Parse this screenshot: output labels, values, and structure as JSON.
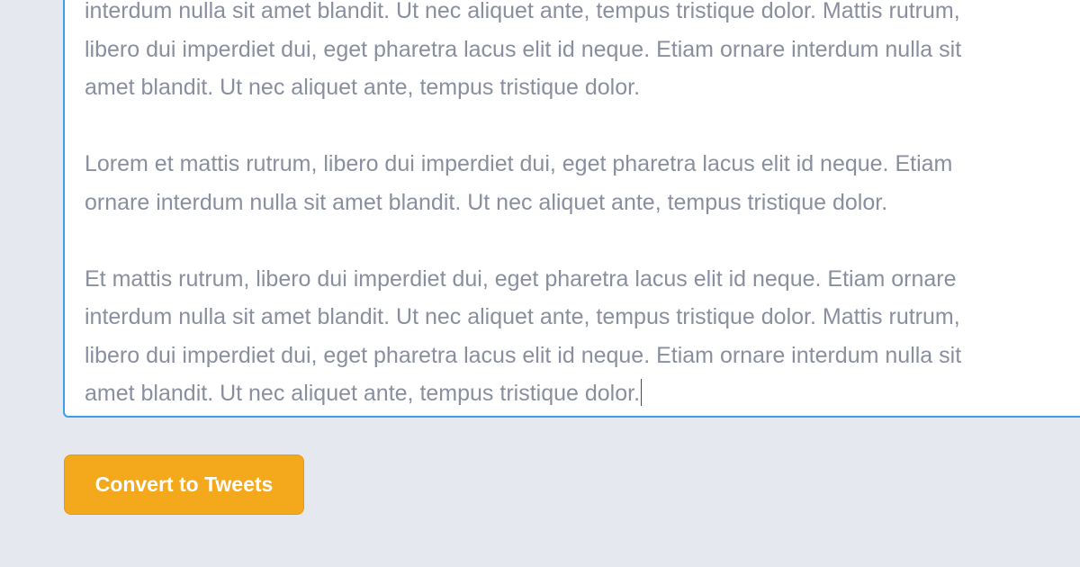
{
  "editor": {
    "paragraphs": [
      {
        "lines": [
          "interdum nulla sit amet blandit. Ut nec aliquet ante, tempus tristique dolor. Mattis rutrum,",
          "libero dui imperdiet dui, eget pharetra lacus elit id neque. Etiam ornare interdum nulla sit",
          "amet blandit. Ut nec aliquet ante, tempus tristique dolor."
        ]
      },
      {
        "lines": [
          "Lorem et mattis rutrum, libero dui imperdiet dui, eget pharetra lacus elit id neque. Etiam",
          "ornare interdum nulla sit amet blandit. Ut nec aliquet ante, tempus tristique dolor."
        ]
      },
      {
        "lines": [
          "Et mattis rutrum, libero dui imperdiet dui, eget pharetra lacus elit id neque. Etiam ornare",
          "interdum nulla sit amet blandit. Ut nec aliquet ante, tempus tristique dolor. Mattis rutrum,",
          "libero dui imperdiet dui, eget pharetra lacus elit id neque. Etiam ornare interdum nulla sit",
          "amet blandit. Ut nec aliquet ante, tempus tristique dolor."
        ]
      }
    ]
  },
  "actions": {
    "convert_label": "Convert to Tweets"
  },
  "colors": {
    "page_background": "#e6e8ef",
    "editor_border": "#3b9ee8",
    "editor_text": "#8a8f9f",
    "button_background": "#f4a81c",
    "button_text": "#ffffff"
  }
}
